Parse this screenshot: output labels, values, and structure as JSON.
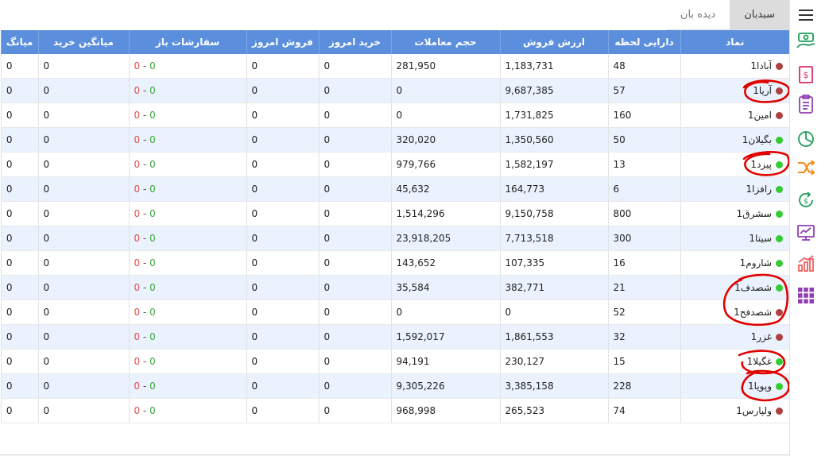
{
  "tabs": [
    {
      "label": "سبدبان",
      "active": true
    },
    {
      "label": "دیده بان",
      "active": false
    }
  ],
  "columns": [
    "نماد",
    "دارایی لحظه",
    "ارزش فروش",
    "حجم معاملات",
    "خرید امروز",
    "فروش امروز",
    "سفارشات باز",
    "میانگین خرید",
    "میانگ"
  ],
  "colors": {
    "header_bg": "#5b8fdd",
    "alt_row": "#eaf2fd",
    "green": "#33cc33",
    "red": "#b04040",
    "annot": "#e00000"
  },
  "rows": [
    {
      "symbol": "آبادا1",
      "status": "red",
      "holding": "48",
      "sell_value": "1,183,731",
      "volume": "281,950",
      "buy_today": "0",
      "sell_today": "0",
      "open_buy": "0",
      "open_sell": "0",
      "avg_buy": "0",
      "avg": "0"
    },
    {
      "symbol": "آریا1",
      "status": "red",
      "holding": "57",
      "sell_value": "9,687,385",
      "volume": "0",
      "buy_today": "0",
      "sell_today": "0",
      "open_buy": "0",
      "open_sell": "0",
      "avg_buy": "0",
      "avg": "0"
    },
    {
      "symbol": "امین1",
      "status": "red",
      "holding": "160",
      "sell_value": "1,731,825",
      "volume": "0",
      "buy_today": "0",
      "sell_today": "0",
      "open_buy": "0",
      "open_sell": "0",
      "avg_buy": "0",
      "avg": "0"
    },
    {
      "symbol": "بگیلان1",
      "status": "green",
      "holding": "50",
      "sell_value": "1,350,560",
      "volume": "320,020",
      "buy_today": "0",
      "sell_today": "0",
      "open_buy": "0",
      "open_sell": "0",
      "avg_buy": "0",
      "avg": "0"
    },
    {
      "symbol": "پیزد1",
      "status": "green",
      "holding": "13",
      "sell_value": "1,582,197",
      "volume": "979,766",
      "buy_today": "0",
      "sell_today": "0",
      "open_buy": "0",
      "open_sell": "0",
      "avg_buy": "0",
      "avg": "0"
    },
    {
      "symbol": "رافزا1",
      "status": "green",
      "holding": "6",
      "sell_value": "164,773",
      "volume": "45,632",
      "buy_today": "0",
      "sell_today": "0",
      "open_buy": "0",
      "open_sell": "0",
      "avg_buy": "0",
      "avg": "0"
    },
    {
      "symbol": "سشرق1",
      "status": "green",
      "holding": "800",
      "sell_value": "9,150,758",
      "volume": "1,514,296",
      "buy_today": "0",
      "sell_today": "0",
      "open_buy": "0",
      "open_sell": "0",
      "avg_buy": "0",
      "avg": "0"
    },
    {
      "symbol": "سیتا1",
      "status": "green",
      "holding": "300",
      "sell_value": "7,713,518",
      "volume": "23,918,205",
      "buy_today": "0",
      "sell_today": "0",
      "open_buy": "0",
      "open_sell": "0",
      "avg_buy": "0",
      "avg": "0"
    },
    {
      "symbol": "شاروم1",
      "status": "green",
      "holding": "16",
      "sell_value": "107,335",
      "volume": "143,652",
      "buy_today": "0",
      "sell_today": "0",
      "open_buy": "0",
      "open_sell": "0",
      "avg_buy": "0",
      "avg": "0"
    },
    {
      "symbol": "شصدف1",
      "status": "green",
      "holding": "21",
      "sell_value": "382,771",
      "volume": "35,584",
      "buy_today": "0",
      "sell_today": "0",
      "open_buy": "0",
      "open_sell": "0",
      "avg_buy": "0",
      "avg": "0"
    },
    {
      "symbol": "شصدفح1",
      "status": "red",
      "holding": "52",
      "sell_value": "0",
      "volume": "0",
      "buy_today": "0",
      "sell_today": "0",
      "open_buy": "0",
      "open_sell": "0",
      "avg_buy": "0",
      "avg": "0"
    },
    {
      "symbol": "غزر1",
      "status": "red",
      "holding": "32",
      "sell_value": "1,861,553",
      "volume": "1,592,017",
      "buy_today": "0",
      "sell_today": "0",
      "open_buy": "0",
      "open_sell": "0",
      "avg_buy": "0",
      "avg": "0"
    },
    {
      "symbol": "غگیلا1",
      "status": "green",
      "holding": "15",
      "sell_value": "230,127",
      "volume": "94,191",
      "buy_today": "0",
      "sell_today": "0",
      "open_buy": "0",
      "open_sell": "0",
      "avg_buy": "0",
      "avg": "0"
    },
    {
      "symbol": "وپویا1",
      "status": "green",
      "holding": "228",
      "sell_value": "3,385,158",
      "volume": "9,305,226",
      "buy_today": "0",
      "sell_today": "0",
      "open_buy": "0",
      "open_sell": "0",
      "avg_buy": "0",
      "avg": "0"
    },
    {
      "symbol": "ولپارس1",
      "status": "red",
      "holding": "74",
      "sell_value": "265,523",
      "volume": "968,998",
      "buy_today": "0",
      "sell_today": "0",
      "open_buy": "0",
      "open_sell": "0",
      "avg_buy": "0",
      "avg": "0"
    }
  ],
  "sidebar_icons": [
    {
      "name": "hamburger-menu-icon",
      "color": "#333333"
    },
    {
      "name": "cash-hand-icon",
      "color": "#1f9d5b"
    },
    {
      "name": "bill-icon",
      "color": "#d62d6a"
    },
    {
      "name": "clipboard-icon",
      "color": "#8e3fb3"
    },
    {
      "name": "pie-chart-icon",
      "color": "#1f9d5b"
    },
    {
      "name": "shuffle-icon",
      "color": "#f28c1a"
    },
    {
      "name": "refresh-dollar-icon",
      "color": "#1f9d5b"
    },
    {
      "name": "monitor-chart-icon",
      "color": "#8e3fb3"
    },
    {
      "name": "growth-chart-icon",
      "color": "#f06060"
    },
    {
      "name": "grid-apps-icon",
      "color": "#8e3fb3"
    }
  ]
}
